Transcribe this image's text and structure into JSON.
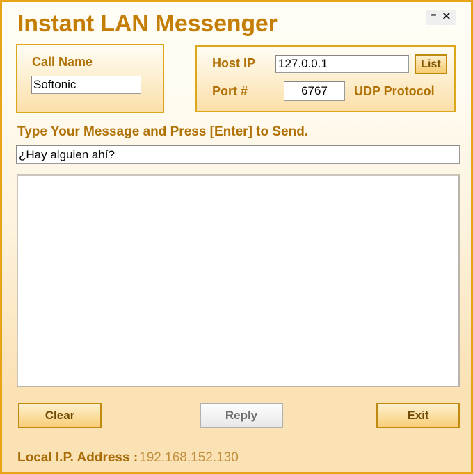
{
  "window": {
    "title": "Instant LAN Messenger",
    "minimize_icon": "minus-icon",
    "minimize_glyph": "–",
    "close_icon": "close-icon",
    "close_glyph": "✕",
    "border_color": "#e8a317",
    "title_color": "#c57e05"
  },
  "call_name_panel": {
    "label": "Call Name",
    "value": "Softonic",
    "placeholder": ""
  },
  "connection_panel": {
    "host_ip_label": "Host IP",
    "host_ip_value": "127.0.0.1",
    "host_ip_placeholder": "",
    "list_button_label": "List",
    "port_label": "Port #",
    "port_value": "6767",
    "port_placeholder": "",
    "protocol_label": "UDP Protocol"
  },
  "message": {
    "prompt": "Type Your Message and Press [Enter] to Send.",
    "input_value": "¿Hay alguien ahí?",
    "input_placeholder": "",
    "chat_log": ""
  },
  "footer": {
    "clear_label": "Clear",
    "reply_label": "Reply",
    "exit_label": "Exit"
  },
  "status": {
    "label": "Local I.P. Address :",
    "value": "192.168.152.130"
  }
}
